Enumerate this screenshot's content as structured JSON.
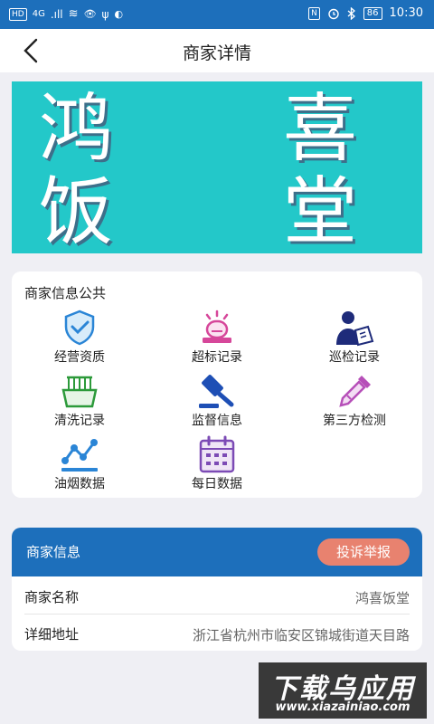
{
  "status_bar": {
    "left": [
      "HD",
      "4G",
      ".ıll",
      "≋",
      "👁",
      "ψ",
      "◐"
    ],
    "right": {
      "nfc": "N",
      "battery": "86",
      "time": "10:30"
    }
  },
  "nav": {
    "title": "商家详情"
  },
  "banner": {
    "chars": [
      "鸿",
      "喜",
      "饭",
      "堂"
    ]
  },
  "public_info": {
    "title": "商家信息公共",
    "items": [
      {
        "label": "经营资质",
        "icon": "shield-check-icon"
      },
      {
        "label": "超标记录",
        "icon": "alarm-icon"
      },
      {
        "label": "巡检记录",
        "icon": "inspector-icon"
      },
      {
        "label": "清洗记录",
        "icon": "basket-icon"
      },
      {
        "label": "监督信息",
        "icon": "gavel-icon"
      },
      {
        "label": "第三方检测",
        "icon": "dropper-icon"
      },
      {
        "label": "油烟数据",
        "icon": "line-chart-icon"
      },
      {
        "label": "每日数据",
        "icon": "calendar-icon"
      }
    ]
  },
  "merchant": {
    "title": "商家信息",
    "complaint_label": "投诉举报",
    "rows": [
      {
        "key": "商家名称",
        "value": "鸿喜饭堂"
      },
      {
        "key": "详细地址",
        "value": "浙江省杭州市临安区锦城街道天目路"
      }
    ]
  },
  "watermark": {
    "top": "下载乌应用",
    "bottom": "www.xiazainiao.com"
  },
  "colors": {
    "primary": "#1d6fbb",
    "banner_bg": "#23c8c9",
    "complaint": "#e8826f"
  }
}
